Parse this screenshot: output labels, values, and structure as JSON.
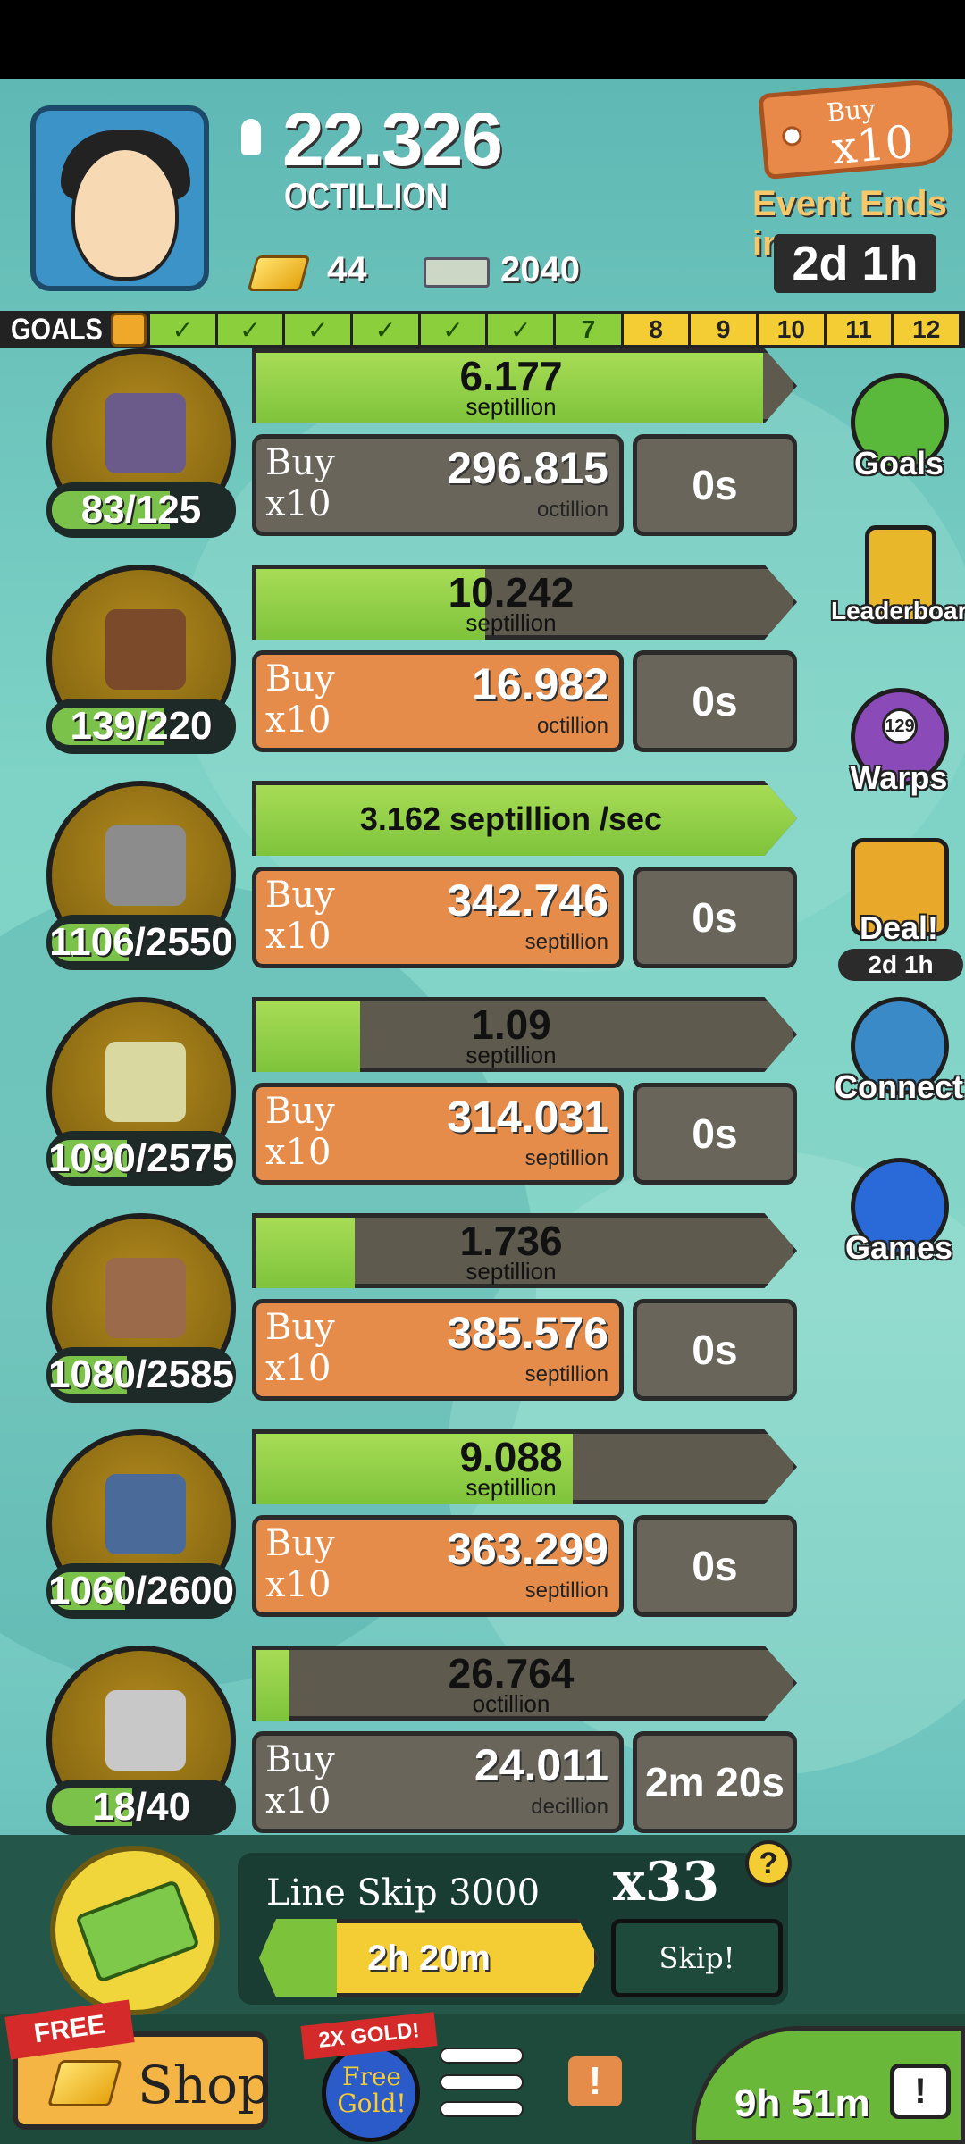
{
  "header": {
    "money_value": "22.326",
    "money_unit": "OCTILLION",
    "gold_count": "44",
    "bills_count": "2040",
    "buy_multiplier": {
      "line1": "Buy",
      "line2": "x10"
    },
    "event_label": "Event Ends in:",
    "event_time": "2d 1h"
  },
  "goals": {
    "label": "GOALS",
    "cells": [
      {
        "label": "✓",
        "done": true
      },
      {
        "label": "✓",
        "done": true
      },
      {
        "label": "✓",
        "done": true
      },
      {
        "label": "✓",
        "done": true
      },
      {
        "label": "✓",
        "done": true
      },
      {
        "label": "✓",
        "done": true
      },
      {
        "label": "7",
        "done": true
      },
      {
        "label": "8",
        "done": false
      },
      {
        "label": "9",
        "done": false
      },
      {
        "label": "10",
        "done": false
      },
      {
        "label": "11",
        "done": false
      },
      {
        "label": "12",
        "done": false
      }
    ]
  },
  "businesses": [
    {
      "count": "83/125",
      "count_progress": 0.66,
      "progress_value": "6.177",
      "progress_unit": "septillion",
      "progress_fill": 0.93,
      "buy_l1": "Buy",
      "buy_l2": "x10",
      "cost": "296.815",
      "cost_unit": "octillion",
      "buy_enabled": false,
      "timer": "0s",
      "art_color": "#6a5b8a"
    },
    {
      "count": "139/220",
      "count_progress": 0.63,
      "progress_value": "10.242",
      "progress_unit": "septillion",
      "progress_fill": 0.42,
      "buy_l1": "Buy",
      "buy_l2": "x10",
      "cost": "16.982",
      "cost_unit": "octillion",
      "buy_enabled": true,
      "timer": "0s",
      "art_color": "#7a4a2a"
    },
    {
      "count": "1106/2550",
      "count_progress": 0.43,
      "progress_rate": "3.162 septillion /sec",
      "progress_fill": 1.0,
      "buy_l1": "Buy",
      "buy_l2": "x10",
      "cost": "342.746",
      "cost_unit": "septillion",
      "buy_enabled": true,
      "timer": "0s",
      "art_color": "#8c8c8c"
    },
    {
      "count": "1090/2575",
      "count_progress": 0.42,
      "progress_value": "1.09",
      "progress_unit": "septillion",
      "progress_fill": 0.19,
      "buy_l1": "Buy",
      "buy_l2": "x10",
      "cost": "314.031",
      "cost_unit": "septillion",
      "buy_enabled": true,
      "timer": "0s",
      "art_color": "#d8d8a0"
    },
    {
      "count": "1080/2585",
      "count_progress": 0.42,
      "progress_value": "1.736",
      "progress_unit": "septillion",
      "progress_fill": 0.18,
      "buy_l1": "Buy",
      "buy_l2": "x10",
      "cost": "385.576",
      "cost_unit": "septillion",
      "buy_enabled": true,
      "timer": "0s",
      "art_color": "#9a6a4a"
    },
    {
      "count": "1060/2600",
      "count_progress": 0.41,
      "progress_value": "9.088",
      "progress_unit": "septillion",
      "progress_fill": 0.58,
      "buy_l1": "Buy",
      "buy_l2": "x10",
      "cost": "363.299",
      "cost_unit": "septillion",
      "buy_enabled": true,
      "timer": "0s",
      "art_color": "#4a6a9a"
    },
    {
      "count": "18/40",
      "count_progress": 0.45,
      "progress_value": "26.764",
      "progress_unit": "octillion",
      "progress_fill": 0.06,
      "buy_l1": "Buy",
      "buy_l2": "x10",
      "cost": "24.011",
      "cost_unit": "decillion",
      "buy_enabled": false,
      "timer": "2m 20s",
      "art_color": "#c8c8c8"
    }
  ],
  "side_menu": {
    "goals": "Goals",
    "leaderboard": "Leaderboard",
    "warps": "Warps",
    "warps_count": "129",
    "deal": "Deal!",
    "deal_timer": "2d 1h",
    "connect": "Connect",
    "games": "Games"
  },
  "line_skip": {
    "title": "Line Skip 3000",
    "multiplier": "x33",
    "help": "?",
    "bar_text": "2h 20m",
    "bar_fill": 0.23,
    "skip": "Skip!"
  },
  "bottom": {
    "free_ribbon": "FREE",
    "shop": "Shop",
    "twox": "2X GOLD!",
    "free_gold": "Free Gold!",
    "alert": "!",
    "tv_time": "9h 51m",
    "tv_icon": "!"
  },
  "colors": {
    "buy_orange": "#e68c4a",
    "bar_green": "#7cc23a",
    "bar_gray": "#5e5a4e",
    "goal_done": "#8ccf3c",
    "goal_todo": "#f4cc34"
  }
}
